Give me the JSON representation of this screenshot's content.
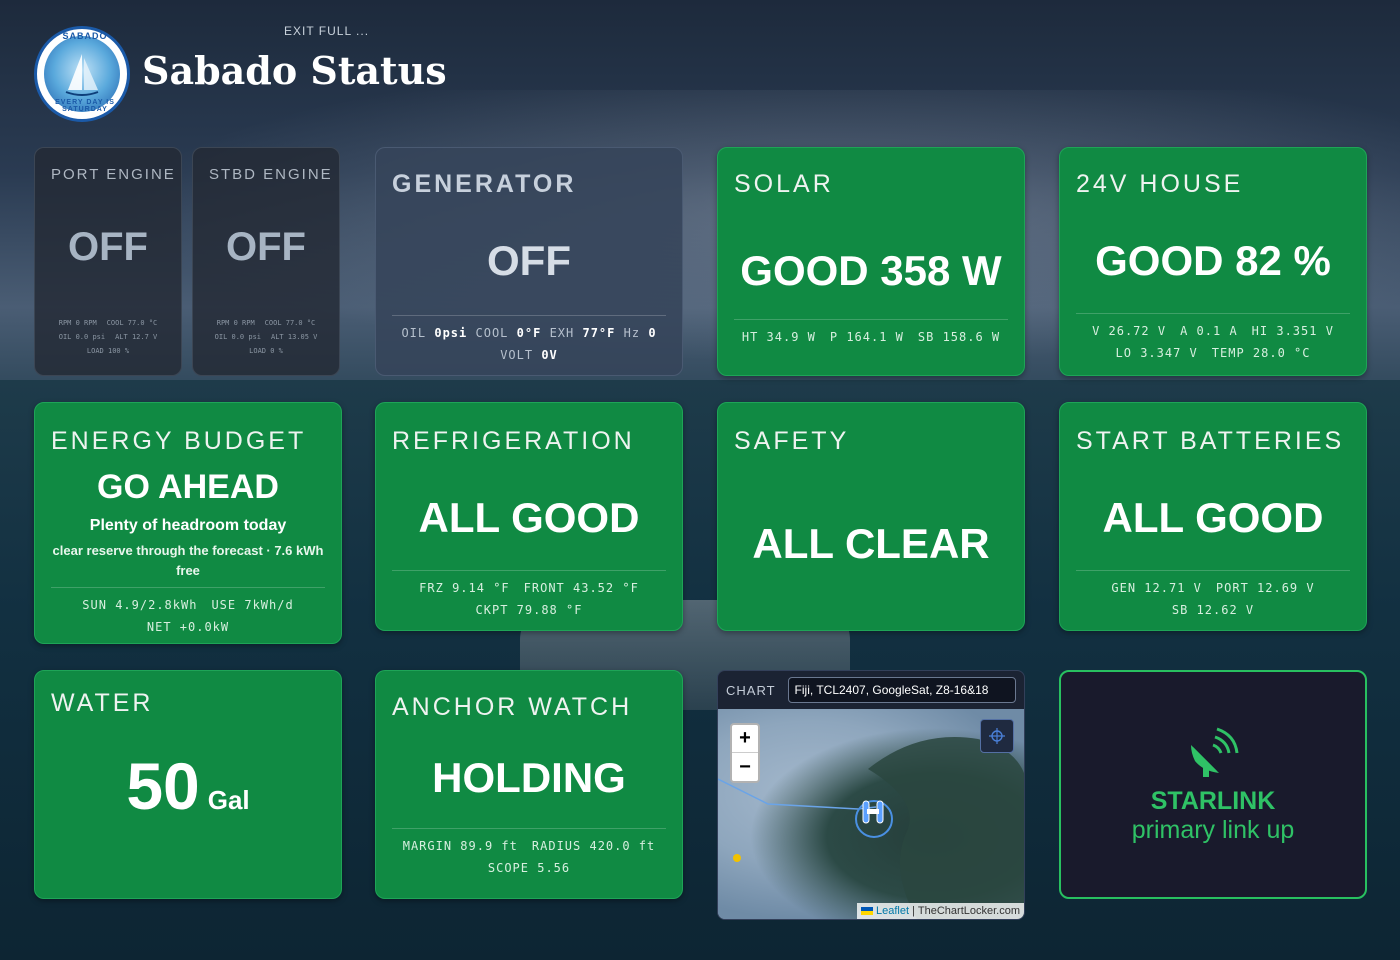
{
  "header": {
    "exit_label": "EXIT FULL ...",
    "title": "Sabado Status",
    "logo_top": "SABADO",
    "logo_bottom": "EVERY DAY IS SATURDAY"
  },
  "port_engine": {
    "label": "PORT ENGINE",
    "value": "OFF",
    "rpm": "RPM 0 RPM",
    "cool": "COOL 77.0 °C",
    "oil": "OIL 0.0 psi",
    "alt": "ALT 12.7 V",
    "load": "LOAD 100 %"
  },
  "stbd_engine": {
    "label": "STBD ENGINE",
    "value": "OFF",
    "rpm": "RPM 0 RPM",
    "cool": "COOL 77.0 °C",
    "oil": "OIL 0.0 psi",
    "alt": "ALT 13.05 V",
    "load": "LOAD 0 %"
  },
  "generator": {
    "label": "GENERATOR",
    "value": "OFF",
    "oil_key": "OIL",
    "oil_val": "0psi",
    "cool_key": "COOL",
    "cool_val": "0°F",
    "exh_key": "EXH",
    "exh_val": "77°F",
    "hz_key": "Hz",
    "hz_val": "0",
    "volt_key": "VOLT",
    "volt_val": "0V"
  },
  "solar": {
    "label": "SOLAR",
    "value": "GOOD 358 W",
    "ht": "HT 34.9 W",
    "p": "P 164.1 W",
    "sb": "SB 158.6 W"
  },
  "house": {
    "label": "24V HOUSE",
    "value": "GOOD 82 %",
    "v": "V 26.72 V",
    "a": "A 0.1 A",
    "hi": "HI 3.351 V",
    "lo": "LO 3.347 V",
    "temp": "TEMP 28.0 °C"
  },
  "energy": {
    "label": "ENERGY BUDGET",
    "value": "GO AHEAD",
    "subtitle": "Plenty of headroom today",
    "note": "clear reserve through the forecast · 7.6 kWh free",
    "sun": "SUN 4.9/2.8kWh",
    "use": "USE 7kWh/d",
    "net": "NET +0.0kW"
  },
  "refrigeration": {
    "label": "REFRIGERATION",
    "value": "ALL GOOD",
    "frz": "FRZ 9.14 °F",
    "front": "FRONT 43.52 °F",
    "ckpt": "CKPT 79.88 °F"
  },
  "safety": {
    "label": "SAFETY",
    "value": "ALL CLEAR"
  },
  "start_batteries": {
    "label": "START BATTERIES",
    "value": "ALL GOOD",
    "gen": "GEN 12.71 V",
    "port": "PORT 12.69 V",
    "sb": "SB 12.62 V"
  },
  "water": {
    "label": "WATER",
    "value": "50",
    "unit": "Gal"
  },
  "anchor": {
    "label": "ANCHOR WATCH",
    "value": "HOLDING",
    "margin": "MARGIN 89.9 ft",
    "radius": "RADIUS 420.0 ft",
    "scope": "SCOPE 5.56"
  },
  "chart": {
    "label": "CHART",
    "selected": "Fiji, TCL2407, GoogleSat, Z8-16&18",
    "zoom_in": "+",
    "zoom_out": "−",
    "attr_leaflet": "Leaflet",
    "attr_source": "TheChartLocker.com"
  },
  "starlink": {
    "name": "STARLINK",
    "status": "primary link up"
  },
  "colors": {
    "ok_green": "#108a43",
    "starlink_green": "#2fc266",
    "off_gray": "#a7b4c3"
  },
  "icons": {
    "starlink": "satellite-dish-icon",
    "locate": "crosshair-icon"
  }
}
